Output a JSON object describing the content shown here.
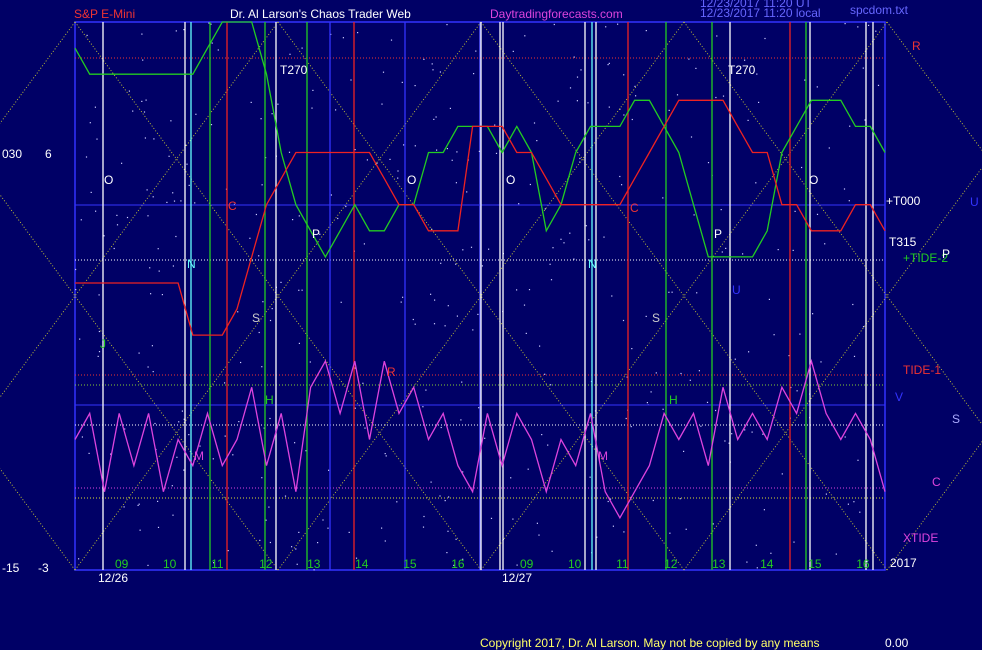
{
  "header": {
    "symbol": "S&P E-Mini",
    "author": "Dr. Al Larson's Chaos Trader Web",
    "site": "Daytradingforecasts.com",
    "stamp1": "12/23/2017 11:20 UT",
    "stamp2": "12/23/2017 11:20 local",
    "file": "spcdom.txt"
  },
  "footer": {
    "copyright": "Copyright 2017, Dr. Al Larson. May not be copied by any means",
    "value": "0.00"
  },
  "colors": {
    "background": "#000066",
    "plot_border": "#3333ff",
    "green_line": "#22cc22",
    "red_line": "#ee2222",
    "magenta_line": "#dd44dd",
    "yellow_grid": "#cccc33"
  },
  "left_axis": {
    "top_a": "030",
    "top_b": "6",
    "bottom_a": "-15",
    "bottom_b": "-3"
  },
  "right_labels": {
    "R": "R",
    "T000": "+T000",
    "U": "U",
    "T315": "T315",
    "TIDE2": "+TIDE-2",
    "P": "P",
    "TIDE1": "TIDE-1",
    "V": "V",
    "S": "S",
    "C": "C",
    "XTIDE": "XTIDE",
    "year": "2017"
  },
  "chart_data": {
    "type": "line",
    "title": "S&P E-Mini",
    "panels": [
      {
        "date": "12/26",
        "hours": [
          "09",
          "10",
          "11",
          "12",
          "13",
          "14",
          "15",
          "16"
        ],
        "markers": [
          "O",
          "C",
          "N",
          "S",
          "P",
          "H",
          "M",
          "J",
          "R",
          "O",
          "T270"
        ]
      },
      {
        "date": "12/27",
        "hours": [
          "09",
          "10",
          "11",
          "12",
          "13",
          "14",
          "15",
          "16"
        ],
        "markers": [
          "O",
          "C",
          "N",
          "S",
          "P",
          "H",
          "M",
          "O",
          "T270",
          "U"
        ]
      }
    ],
    "series": [
      {
        "name": "TIDE-2",
        "color": "#22cc22",
        "values": [
          5,
          4,
          4,
          4,
          4,
          4,
          4,
          4,
          4,
          5,
          6,
          6,
          6,
          4,
          1,
          -1,
          -2,
          -3,
          -2,
          -1,
          -2,
          -2,
          -1,
          -1,
          1,
          1,
          2,
          2,
          2,
          1,
          2,
          1,
          -2,
          -1,
          1,
          2,
          2,
          2,
          3,
          3,
          2,
          1,
          -1,
          -3,
          -3,
          -3,
          -3,
          -2,
          1,
          2,
          3,
          3,
          3,
          2,
          2,
          1
        ]
      },
      {
        "name": "TIDE-1",
        "color": "#ee2222",
        "values": [
          -4,
          -4,
          -4,
          -4,
          -4,
          -4,
          -4,
          -4,
          -6,
          -6,
          -6,
          -5,
          -3,
          -1,
          0,
          1,
          1,
          1,
          1,
          1,
          1,
          0,
          -1,
          -1,
          -2,
          -2,
          -2,
          2,
          2,
          2,
          1,
          1,
          0,
          -1,
          -1,
          -1,
          -1,
          -1,
          0,
          1,
          2,
          3,
          3,
          3,
          3,
          2,
          1,
          1,
          -1,
          -1,
          -2,
          -2,
          -2,
          -1,
          -1,
          -2
        ]
      },
      {
        "name": "XTIDE",
        "color": "#dd44dd",
        "values": [
          -10,
          -9,
          -12,
          -9,
          -11,
          -9,
          -12,
          -10,
          -11,
          -9,
          -11,
          -10,
          -8,
          -11,
          -9,
          -12,
          -8,
          -7,
          -9,
          -7,
          -10,
          -7,
          -9,
          -8,
          -10,
          -9,
          -11,
          -12,
          -9,
          -11,
          -9,
          -10,
          -12,
          -10,
          -11,
          -9,
          -12,
          -13,
          -12,
          -11,
          -9,
          -10,
          -9,
          -11,
          -8,
          -10,
          -9,
          -10,
          -8,
          -9,
          -7,
          -9,
          -10,
          -9,
          -10,
          -12
        ]
      }
    ],
    "ylim": [
      -15,
      6
    ]
  }
}
